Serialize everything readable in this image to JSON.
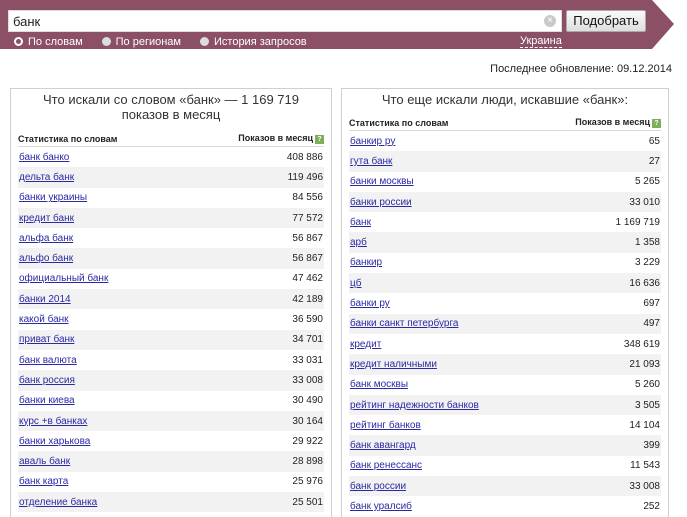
{
  "search": {
    "query": "банк",
    "submit_label": "Подобрать"
  },
  "modes": [
    {
      "label": "По словам",
      "selected": true
    },
    {
      "label": "По регионам",
      "selected": false
    },
    {
      "label": "История запросов",
      "selected": false
    }
  ],
  "region": "Украина",
  "last_update": "Последнее обновление: 09.12.2014",
  "colors": {
    "header_bg": "#8b4f66",
    "link": "#2a2aa5",
    "help_icon": "#7fae5b"
  },
  "left_panel": {
    "title": "Что искали со словом «банк» — 1 169 719 показов в месяц",
    "col_phrase": "Статистика по словам",
    "col_count": "Показов в месяц",
    "help_icon_glyph": "?",
    "rows": [
      {
        "phrase": "банк банко",
        "count": "408 886"
      },
      {
        "phrase": "дельта банк",
        "count": "119 496"
      },
      {
        "phrase": "банки украины",
        "count": "84 556"
      },
      {
        "phrase": "кредит банк",
        "count": "77 572"
      },
      {
        "phrase": "альфа банк",
        "count": "56 867"
      },
      {
        "phrase": "альфо банк",
        "count": "56 867"
      },
      {
        "phrase": "официальный банк",
        "count": "47 462"
      },
      {
        "phrase": "банки 2014",
        "count": "42 189"
      },
      {
        "phrase": "какой банк",
        "count": "36 590"
      },
      {
        "phrase": "приват банк",
        "count": "34 701"
      },
      {
        "phrase": "банк валюта",
        "count": "33 031"
      },
      {
        "phrase": "банк россия",
        "count": "33 008"
      },
      {
        "phrase": "банки киева",
        "count": "30 490"
      },
      {
        "phrase": "курс +в банках",
        "count": "30 164"
      },
      {
        "phrase": "банки харькова",
        "count": "29 922"
      },
      {
        "phrase": "аваль банк",
        "count": "28 898"
      },
      {
        "phrase": "банк карта",
        "count": "25 976"
      },
      {
        "phrase": "отделение банка",
        "count": "25 501"
      }
    ]
  },
  "right_panel": {
    "title": "Что еще искали люди, искавшие «банк»:",
    "col_phrase": "Статистика по словам",
    "col_count": "Показов в месяц",
    "help_icon_glyph": "?",
    "rows": [
      {
        "phrase": "банкир ру",
        "count": "65"
      },
      {
        "phrase": "гута банк",
        "count": "27"
      },
      {
        "phrase": "банки москвы",
        "count": "5 265"
      },
      {
        "phrase": "банки россии",
        "count": "33 010"
      },
      {
        "phrase": "банк",
        "count": "1 169 719"
      },
      {
        "phrase": "арб",
        "count": "1 358"
      },
      {
        "phrase": "банкир",
        "count": "3 229"
      },
      {
        "phrase": "цб",
        "count": "16 636"
      },
      {
        "phrase": "банки ру",
        "count": "697"
      },
      {
        "phrase": "банки санкт петербурга",
        "count": "497"
      },
      {
        "phrase": "кредит",
        "count": "348 619"
      },
      {
        "phrase": "кредит наличными",
        "count": "21 093"
      },
      {
        "phrase": "банк москвы",
        "count": "5 260"
      },
      {
        "phrase": "рейтинг надежности банков",
        "count": "3 505"
      },
      {
        "phrase": "рейтинг банков",
        "count": "14 104"
      },
      {
        "phrase": "банк авангард",
        "count": "399"
      },
      {
        "phrase": "банк ренессанс",
        "count": "11 543"
      },
      {
        "phrase": "банк россии",
        "count": "33 008"
      },
      {
        "phrase": "банк уралсиб",
        "count": "252"
      }
    ]
  }
}
